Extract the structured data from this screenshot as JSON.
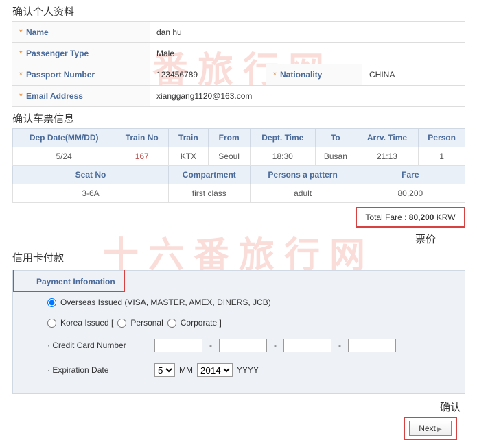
{
  "watermark": "十六番旅行网",
  "personal": {
    "title": "确认个人资料",
    "name_label": "Name",
    "name_value": "dan hu",
    "ptype_label": "Passenger Type",
    "ptype_value": "Male",
    "passport_label": "Passport Number",
    "passport_value": "123456789",
    "nationality_label": "Nationality",
    "nationality_value": "CHINA",
    "email_label": "Email Address",
    "email_value": "xianggang1120@163.com"
  },
  "ticket": {
    "title": "确认车票信息",
    "headers1": [
      "Dep Date(MM/DD)",
      "Train No",
      "Train",
      "From",
      "Dept. Time",
      "To",
      "Arrv. Time",
      "Person"
    ],
    "row1": {
      "dep": "5/24",
      "trainno": "167",
      "train": "KTX",
      "from": "Seoul",
      "dtime": "18:30",
      "to": "Busan",
      "atime": "21:13",
      "person": "1"
    },
    "headers2": [
      "Seat No",
      "Compartment",
      "Persons a pattern",
      "Fare"
    ],
    "row2": {
      "seat": "3-6A",
      "comp": "first class",
      "pattern": "adult",
      "fare": "80,200"
    },
    "total_label": "Total Fare : ",
    "total_value": "80,200",
    "total_currency": " KRW",
    "price_label": "票价"
  },
  "payment": {
    "title": "信用卡付款",
    "header": "Payment Infomation",
    "overseas": "Overseas Issued (VISA, MASTER, AMEX, DINERS, JCB)",
    "korea": "Korea Issued [",
    "personal": "Personal",
    "corporate": "Corporate ]",
    "cc_label": "· Credit Card Number",
    "exp_label": "· Expiration Date",
    "mm": "MM",
    "yyyy": "YYYY",
    "month_sel": "5",
    "year_sel": "2014",
    "confirm": "确认",
    "next": "Next"
  }
}
